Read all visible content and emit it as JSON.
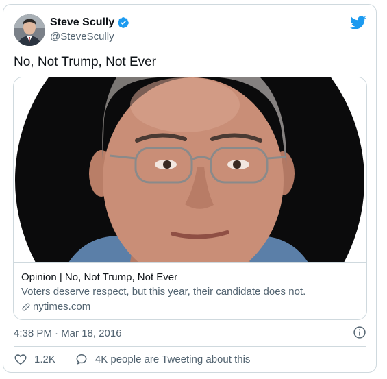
{
  "author": {
    "name": "Steve Scully",
    "handle": "@SteveScully",
    "verified_icon": "verified-badge-icon",
    "brand_icon": "twitter-bird-icon"
  },
  "tweet": {
    "text": "No, Not Trump, Not Ever",
    "timestamp": "4:38 PM · Mar 18, 2016"
  },
  "card": {
    "image": "portrait-photo",
    "title": "Opinion | No, Not Trump, Not Ever",
    "description": "Voters deserve respect, but this year, their candidate does not.",
    "domain": "nytimes.com",
    "link_icon": "link-icon"
  },
  "actions": {
    "likes": "1.2K",
    "like_icon": "heart-icon",
    "conversation": "4K people are Tweeting about this",
    "conversation_icon": "speech-bubble-icon",
    "info_icon": "info-icon"
  },
  "colors": {
    "twitter_blue": "#1d9bf0",
    "secondary_text": "#536471",
    "border": "#cfd9de"
  }
}
